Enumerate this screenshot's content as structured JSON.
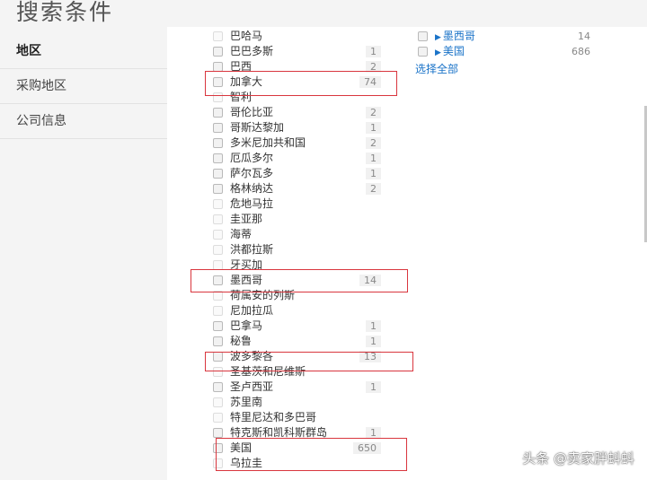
{
  "page": {
    "title": "搜索条件"
  },
  "sidebar": {
    "items": [
      {
        "label": "地区",
        "active": true
      },
      {
        "label": "采购地区",
        "active": false
      },
      {
        "label": "公司信息",
        "active": false
      }
    ]
  },
  "countries": [
    {
      "name": "巴哈马",
      "count": ""
    },
    {
      "name": "巴巴多斯",
      "count": "1"
    },
    {
      "name": "巴西",
      "count": "2"
    },
    {
      "name": "加拿大",
      "count": "74"
    },
    {
      "name": "智利",
      "count": ""
    },
    {
      "name": "哥伦比亚",
      "count": "2"
    },
    {
      "name": "哥斯达黎加",
      "count": "1"
    },
    {
      "name": "多米尼加共和国",
      "count": "2"
    },
    {
      "name": "厄瓜多尔",
      "count": "1"
    },
    {
      "name": "萨尔瓦多",
      "count": "1"
    },
    {
      "name": "格林纳达",
      "count": "2"
    },
    {
      "name": "危地马拉",
      "count": ""
    },
    {
      "name": "圭亚那",
      "count": ""
    },
    {
      "name": "海蒂",
      "count": ""
    },
    {
      "name": "洪都拉斯",
      "count": ""
    },
    {
      "name": "牙买加",
      "count": ""
    },
    {
      "name": "墨西哥",
      "count": "14"
    },
    {
      "name": "荷属安的列斯",
      "count": ""
    },
    {
      "name": "尼加拉瓜",
      "count": ""
    },
    {
      "name": "巴拿马",
      "count": "1"
    },
    {
      "name": "秘鲁",
      "count": "1"
    },
    {
      "name": "波多黎各",
      "count": "13"
    },
    {
      "name": "圣基茨和尼维斯",
      "count": ""
    },
    {
      "name": "圣卢西亚",
      "count": "1"
    },
    {
      "name": "苏里南",
      "count": ""
    },
    {
      "name": "特里尼达和多巴哥",
      "count": ""
    },
    {
      "name": "特克斯和凯科斯群岛",
      "count": "1"
    },
    {
      "name": "美国",
      "count": "650"
    },
    {
      "name": "乌拉圭",
      "count": ""
    }
  ],
  "regions": [
    {
      "name": "墨西哥",
      "count": "14",
      "arrow": "▶"
    },
    {
      "name": "美国",
      "count": "686",
      "arrow": "▶"
    }
  ],
  "select_all": "选择全部",
  "watermark": "头条 @卖家胖蚪蚪",
  "colors": {
    "highlight": "#d9363e",
    "link": "#1a73c8"
  }
}
